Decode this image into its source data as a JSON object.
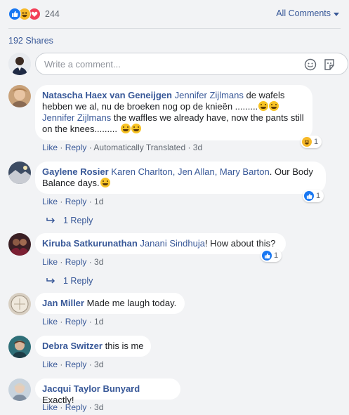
{
  "reactions": {
    "count": "244",
    "icons": [
      "like-icon",
      "haha-icon",
      "love-icon"
    ]
  },
  "all_comments_label": "All Comments",
  "shares_label": "192 Shares",
  "composer": {
    "placeholder": "Write a comment..."
  },
  "labels": {
    "like": "Like",
    "reply": "Reply",
    "dot": " · ",
    "translated": "Automatically Translated"
  },
  "comments": [
    {
      "author": "Natascha Haex van Geneijgen",
      "tag1": "Jennifer Zijlmans",
      "text1": " de wafels hebben we al, nu de broeken nog op de knieën .........",
      "tag2": "Jennifer Zijlmans",
      "text2": " the waffles we already have, now the pants still on the knees.........",
      "time": "3d",
      "reaction_count": "1"
    },
    {
      "author": "Gaylene Rosier",
      "tags": "Karen Charlton, Jen Allan, Mary Barton",
      "text": ". Our Body Balance days.",
      "time": "1d",
      "reaction_count": "1",
      "replies": "1 Reply"
    },
    {
      "author": "Kiruba Satkurunathan",
      "tags": "Janani Sindhuja",
      "text": "! How about this?",
      "time": "3d",
      "reaction_count": "1",
      "replies": "1 Reply"
    },
    {
      "author": "Jan Miller",
      "text": "Made me laugh today.",
      "time": "1d"
    },
    {
      "author": "Debra Switzer",
      "text": "this is me",
      "time": "3d"
    },
    {
      "author": "Jacqui Taylor Bunyard",
      "text": "Exactly!",
      "time": "3d"
    }
  ],
  "colors": {
    "link": "#385898",
    "like_blue": "#1877f2",
    "background": "#f2f3f5",
    "bubble": "#ffffff"
  }
}
